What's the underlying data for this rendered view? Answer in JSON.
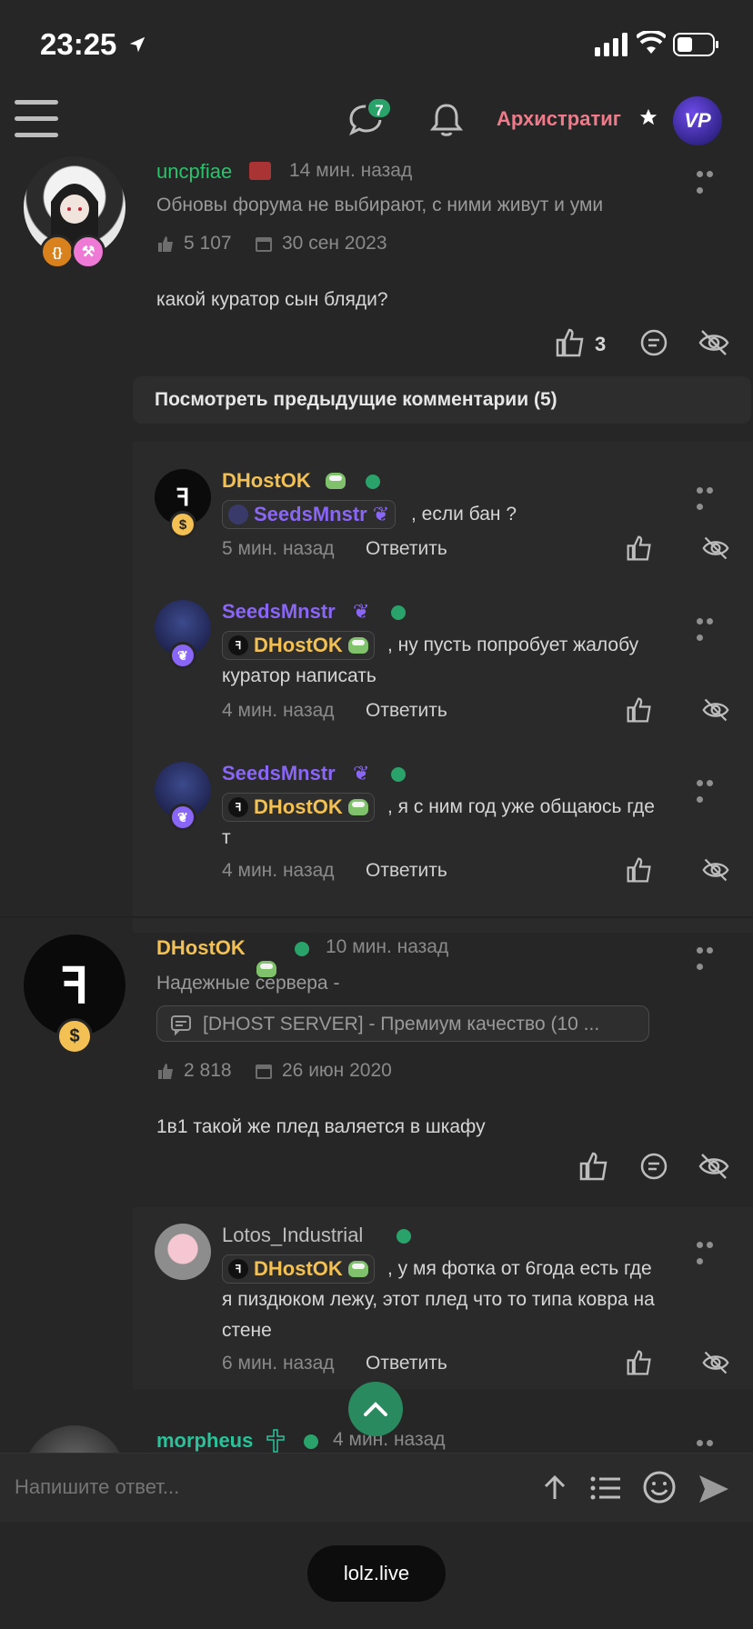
{
  "status_bar": {
    "time": "23:25"
  },
  "nav": {
    "chat_badge": "7",
    "username": "Архистратиг",
    "avatar_text": "VP"
  },
  "post1": {
    "username": "uncpfiae",
    "time": "14 мин. назад",
    "user_title": "Обновы форума не выбирают, с ними живут и уми",
    "likes": "5 107",
    "joined": "30 сен 2023",
    "message": "какой куратор сын бляди?",
    "like_count": "3"
  },
  "prev_comments": "Посмотреть предыдущие комментарии (5)",
  "replies1": [
    {
      "username": "DHostOK",
      "mention": "SeedsMnstr",
      "text": ", если бан ?",
      "text2": "",
      "time": "5 мин. назад",
      "reply": "Ответить"
    },
    {
      "username": "SeedsMnstr",
      "mention": "DHostOK",
      "text": ", ну пусть попробует жалобу",
      "text2": "куратор написать",
      "time": "4 мин. назад",
      "reply": "Ответить"
    },
    {
      "username": "SeedsMnstr",
      "mention": "DHostOK",
      "text": ", я с ним год уже общаюсь где",
      "text2": "т",
      "time": "4 мин. назад",
      "reply": "Ответить"
    }
  ],
  "post2": {
    "username": "DHostOK",
    "time": "10 мин. назад",
    "user_title": "Надежные сервера -",
    "thread_link": "[DHOST SERVER] - Премиум качество (10 ...",
    "likes": "2 818",
    "joined": "26 июн 2020",
    "message": "1в1 такой же плед валяется в шкафу"
  },
  "reply2": {
    "username": "Lotos_Industrial",
    "mention": "DHostOK",
    "text": ", у мя фотка от 6года есть где",
    "text2": "я пиздюком лежу, этот плед что то типа ковра на",
    "text3": "стене",
    "time": "6 мин. назад",
    "reply": "Ответить"
  },
  "post3": {
    "username": "morpheus",
    "time": "4 мин. назад"
  },
  "reply_bar": {
    "placeholder": "Напишите ответ..."
  },
  "browser": {
    "url": "lolz.live"
  },
  "colors": {
    "accent": "#2aa36b",
    "gold": "#f3c053",
    "purple": "#8a66f6",
    "green_name": "#2bc26c"
  }
}
